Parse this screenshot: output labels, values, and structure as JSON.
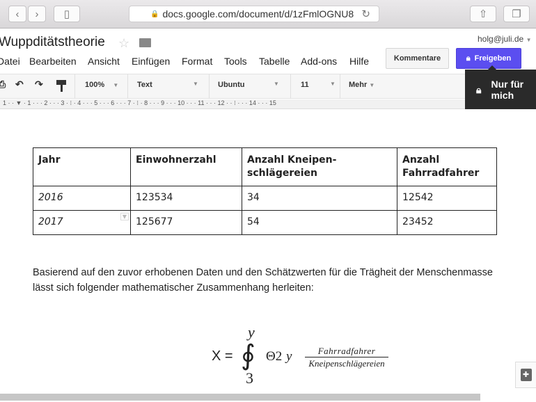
{
  "browser": {
    "url": "docs.google.com/document/d/1zFmlOGNU8"
  },
  "doc": {
    "title": "Wuppditätstheorie",
    "user": "holg@juli.de",
    "menu": [
      "Datei",
      "Bearbeiten",
      "Ansicht",
      "Einfügen",
      "Format",
      "Tools",
      "Tabelle",
      "Add-ons",
      "Hilfe"
    ],
    "comments_label": "Kommentare",
    "share_label": "Freigeben",
    "tooltip": "Nur für mich"
  },
  "toolbar": {
    "zoom": "100%",
    "style": "Text",
    "font": "Ubuntu",
    "size": "11",
    "more": "Mehr"
  },
  "ruler": "1 · · ▼ · 1 · · · 2 · · · 3 · ⁝ · 4 · · · 5 · · · 6 · · · 7 · ⁝ · 8 · · · 9 · · · 10 · · · 11 · · · 12 · · ⁝ · · · 14 · · · 15",
  "table": {
    "headers": [
      "Jahr",
      "Einwohnerzahl",
      "Anzahl Kneipen-schlägereien",
      "Anzahl Fahrradfahrer"
    ],
    "rows": [
      [
        "2016",
        "123534",
        "34",
        "12542"
      ],
      [
        "2017",
        "125677",
        "54",
        "23452"
      ]
    ]
  },
  "paragraph": "Basierend auf den zuvor erhobenen Daten und den Schätzwerten für die Trägheit der Menschenmasse lässt sich folgender mathematischer Zusammenhang herleiten:",
  "formula": {
    "lhs": "X =",
    "upper": "y",
    "lower": "3",
    "integral": "∮",
    "term": "Θ2",
    "var": "y",
    "numerator": "Fahrradfahrer",
    "denominator": "Kneipenschlägereien"
  }
}
